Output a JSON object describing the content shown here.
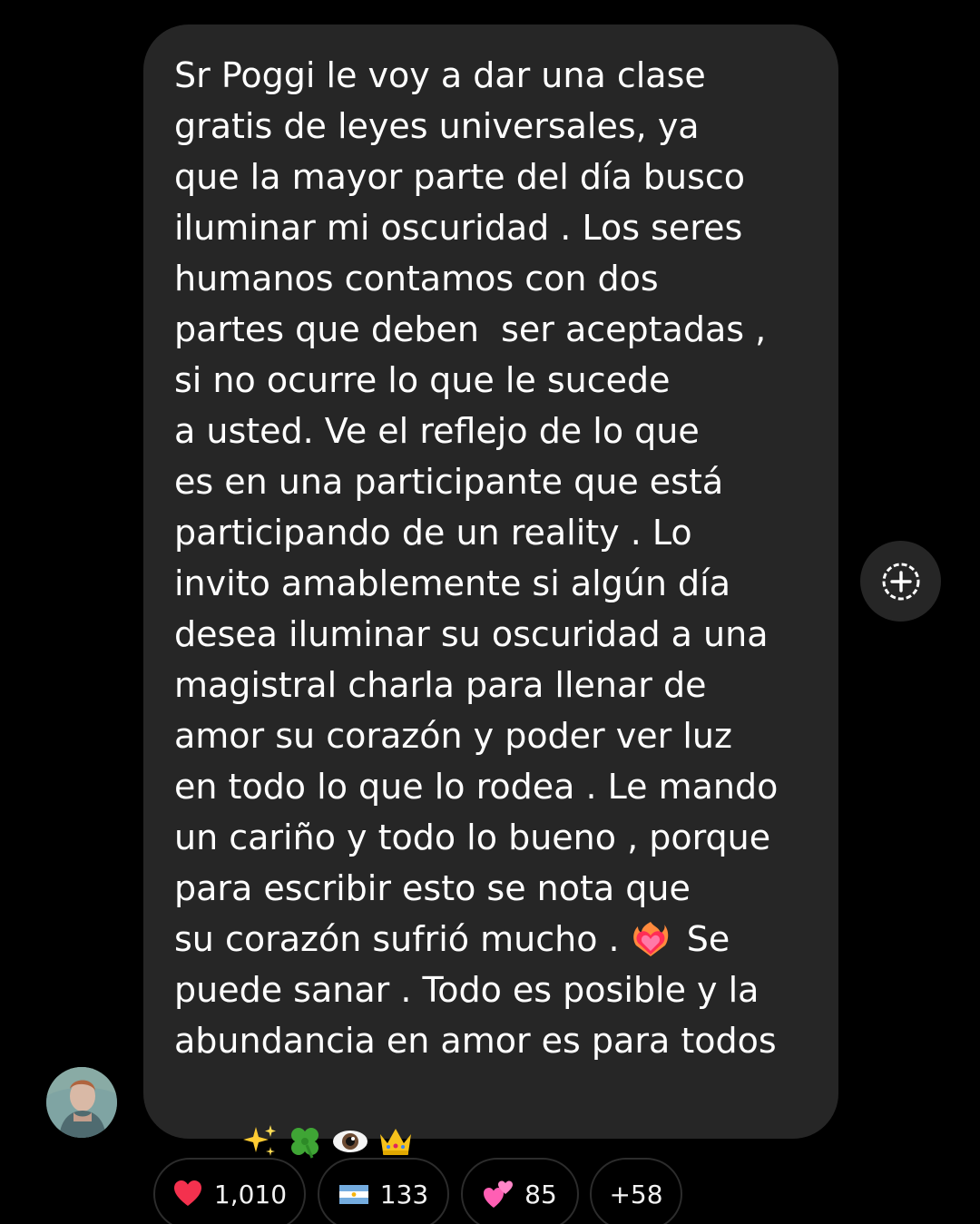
{
  "message": {
    "lines": [
      "Sr Poggi le voy a dar una clase",
      "gratis de leyes universales, ya",
      "que la mayor parte del día busco",
      "iluminar mi oscuridad . Los seres",
      "humanos contamos con dos",
      "partes que deben  ser aceptadas ,",
      "si no ocurre lo que le sucede",
      "a usted. Ve el reflejo de lo que",
      "es en una participante que está",
      "participando de un reality . Lo",
      "invito amablemente si algún día",
      "desea iluminar su oscuridad a una",
      "magistral charla para llenar de",
      "amor su corazón y poder ver luz",
      "en todo lo que lo rodea . Le mando",
      "un cariño y todo lo bueno , porque",
      "para escribir esto se nota que"
    ],
    "line_18_before_emoji": "su corazón sufrió mucho . ",
    "line_18_after_emoji": " Se",
    "line_19": "puede sanar . Todo es posible y la",
    "line_20": "abundancia en amor es para todos",
    "inline_emoji": "heart-on-fire-icon",
    "trailing_emojis": [
      "sparkles-icon",
      "four-leaf-clover-icon",
      "eye-icon",
      "crown-icon"
    ]
  },
  "add_button": {
    "icon": "add-reaction-icon"
  },
  "reactions": [
    {
      "icon": "red-heart-icon",
      "count": "1,010"
    },
    {
      "icon": "argentina-flag-icon",
      "count": "133"
    },
    {
      "icon": "two-hearts-icon",
      "count": "85"
    },
    {
      "icon": "",
      "count": "+58"
    }
  ],
  "colors": {
    "background": "#000000",
    "bubble": "#262626",
    "text": "#ffffff",
    "pill_border": "#2c2c2c"
  }
}
